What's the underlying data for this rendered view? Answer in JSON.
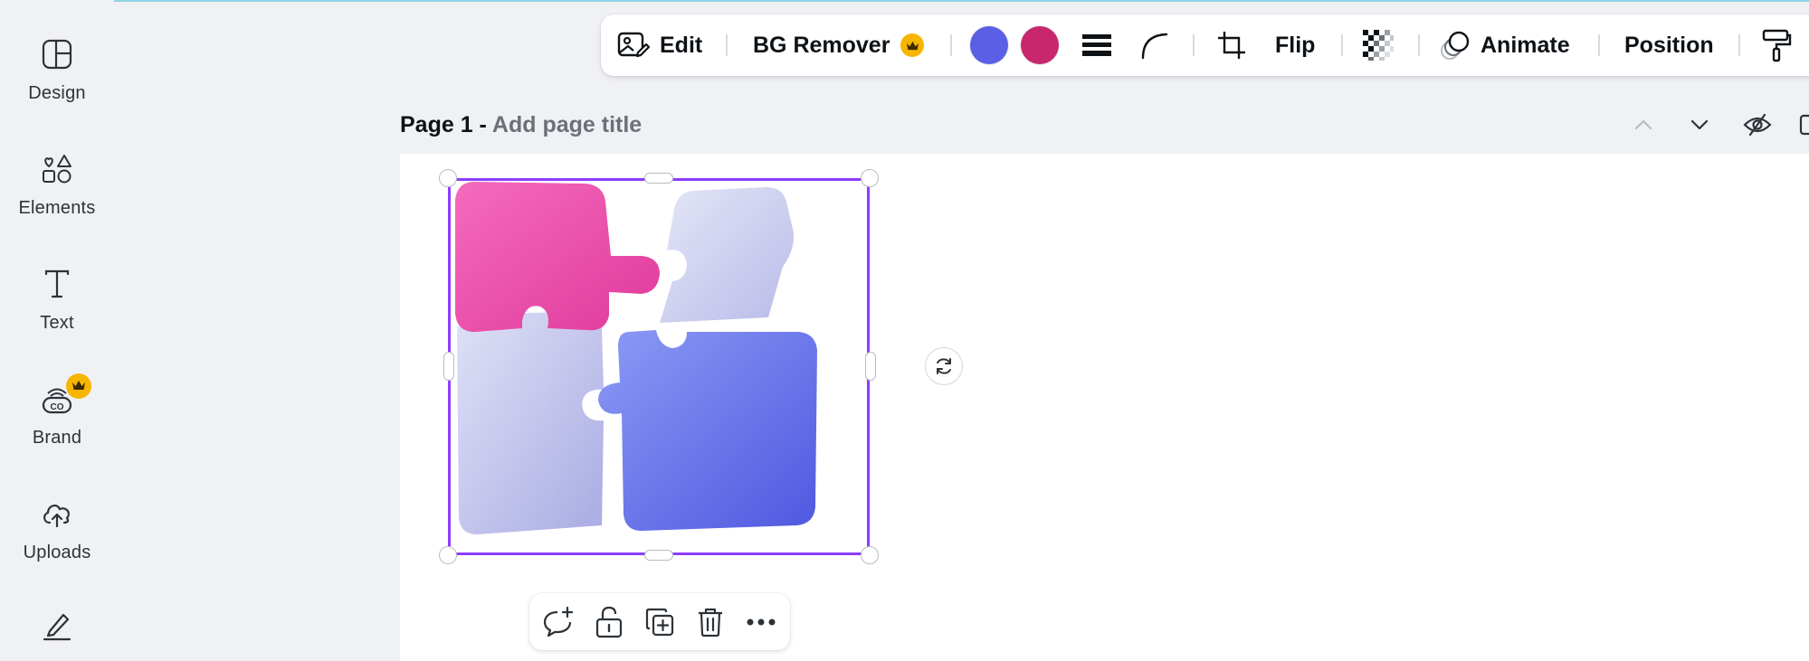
{
  "sidebar": {
    "items": [
      {
        "label": "Design",
        "icon": "layout-icon"
      },
      {
        "label": "Elements",
        "icon": "shapes-icon"
      },
      {
        "label": "Text",
        "icon": "text-icon"
      },
      {
        "label": "Brand",
        "icon": "brand-icon",
        "premium": true
      },
      {
        "label": "Uploads",
        "icon": "cloud-upload-icon"
      },
      {
        "label": "",
        "icon": "draw-icon"
      }
    ]
  },
  "toolbar": {
    "edit_label": "Edit",
    "bg_remover_label": "BG Remover",
    "color_swatches": [
      "#5b5fe6",
      "#c8276e"
    ],
    "flip_label": "Flip",
    "animate_label": "Animate",
    "position_label": "Position"
  },
  "page": {
    "prefix": "Page 1 -",
    "title_placeholder": "Add page title"
  },
  "colors": {
    "accent": "#8b3dff",
    "premium": "#f7b500",
    "canvas_bg": "#ffffff",
    "app_bg": "#f0f1f5"
  }
}
